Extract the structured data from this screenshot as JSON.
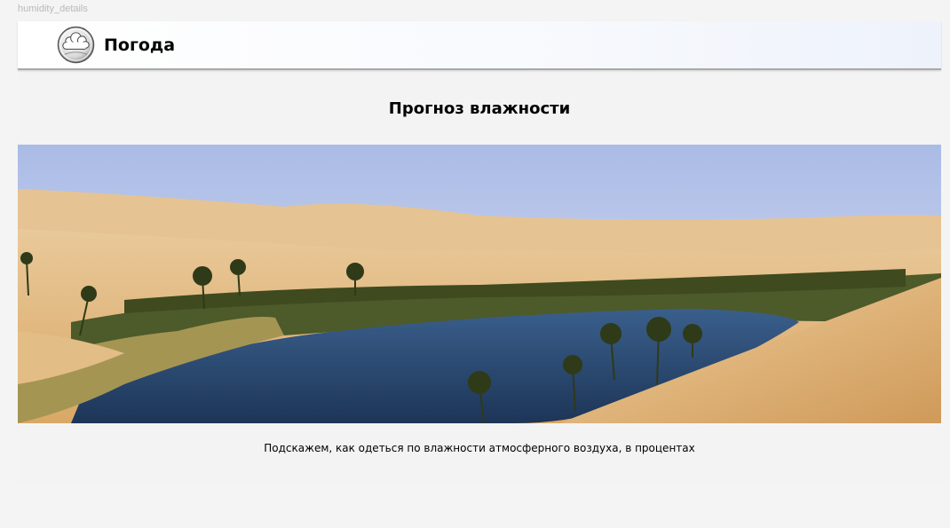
{
  "frame": {
    "label": "humidity_details"
  },
  "header": {
    "logo_icon": "cloud-logo-icon",
    "brand": "Погода"
  },
  "main": {
    "title": "Прогноз влажности",
    "hero_image": "desert-oasis-image",
    "caption": "Подскажем, как одеться по влажности атмосферного воздуха, в процентах"
  }
}
